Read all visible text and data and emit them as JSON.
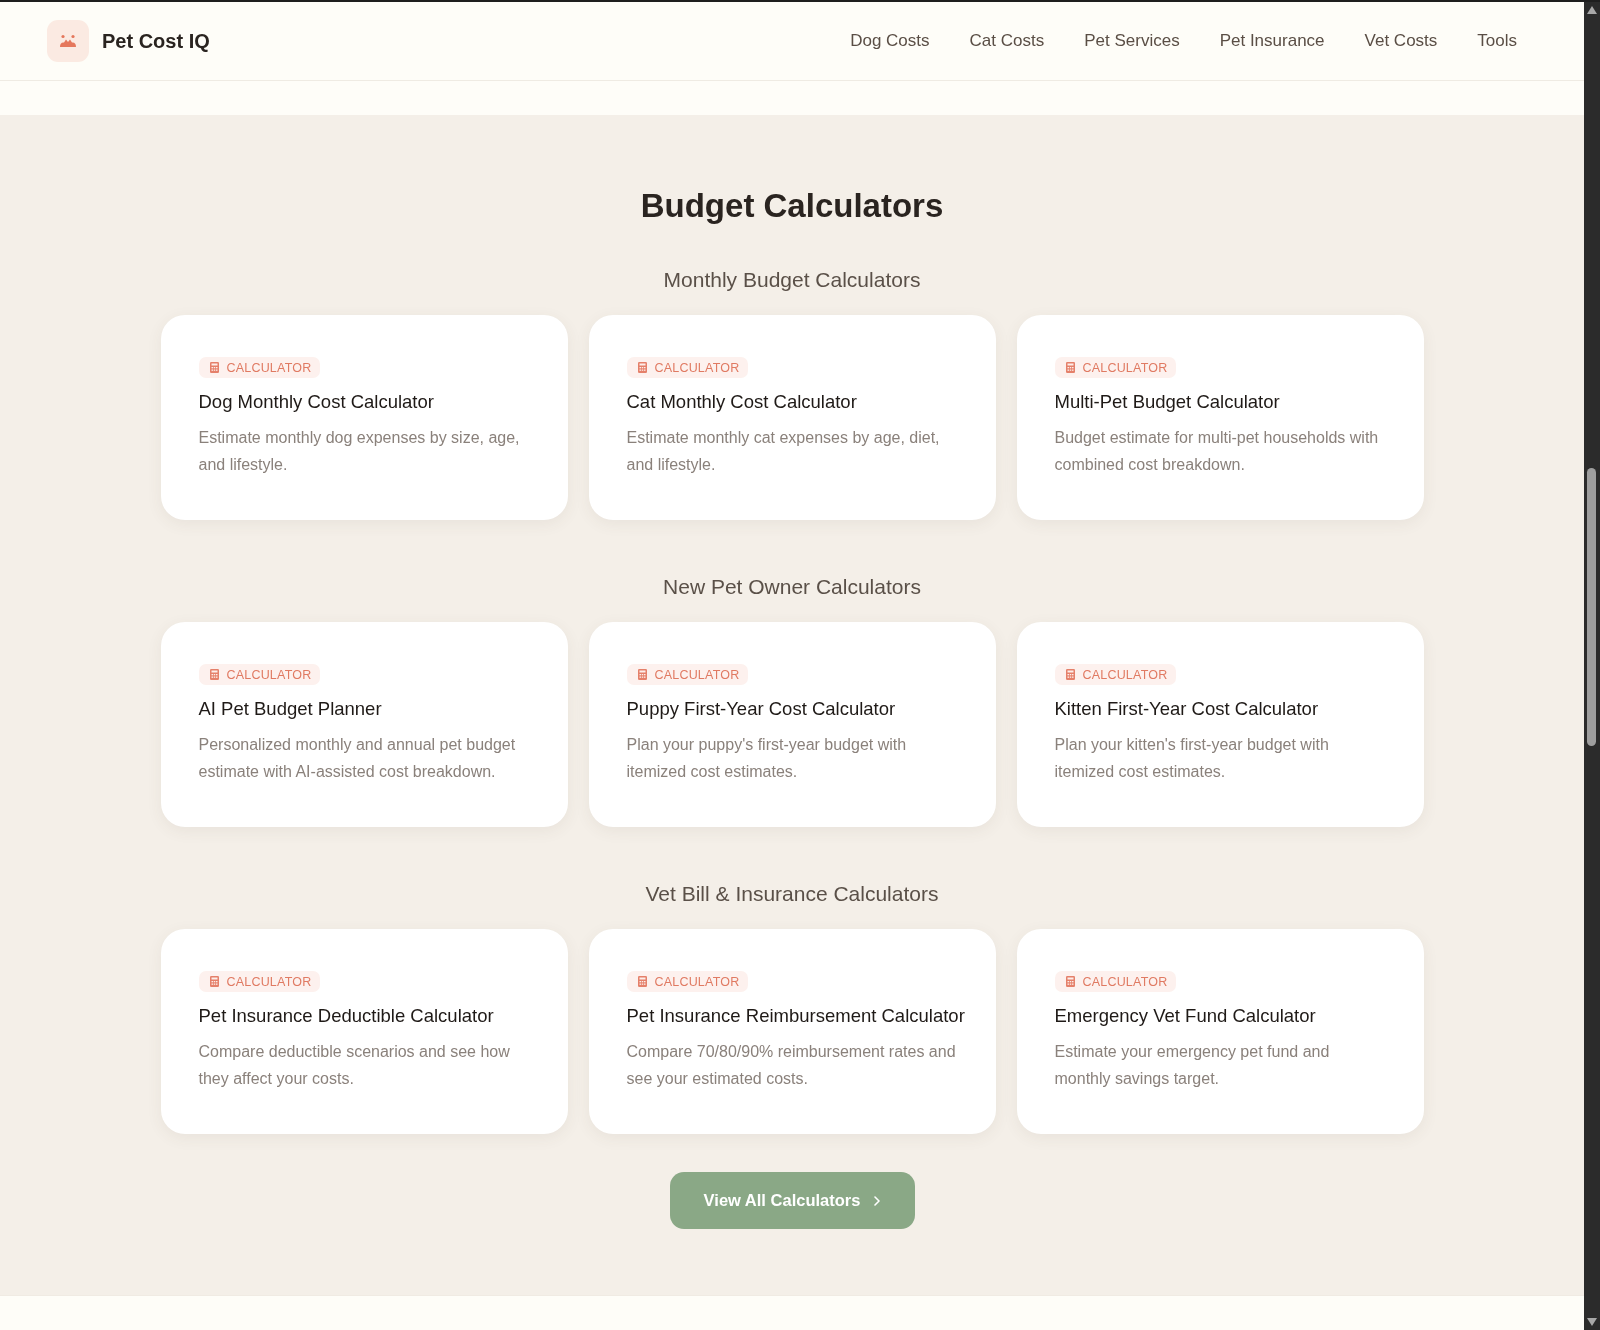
{
  "header": {
    "brand": "Pet Cost IQ",
    "nav": [
      "Dog Costs",
      "Cat Costs",
      "Pet Services",
      "Pet Insurance",
      "Vet Costs",
      "Tools"
    ]
  },
  "section": {
    "title": "Budget Calculators",
    "groups": [
      {
        "title": "Monthly Budget Calculators",
        "cards": [
          {
            "badge": "CALCULATOR",
            "title": "Dog Monthly Cost Calculator",
            "description": "Estimate monthly dog expenses by size, age, and lifestyle."
          },
          {
            "badge": "CALCULATOR",
            "title": "Cat Monthly Cost Calculator",
            "description": "Estimate monthly cat expenses by age, diet, and lifestyle."
          },
          {
            "badge": "CALCULATOR",
            "title": "Multi-Pet Budget Calculator",
            "description": "Budget estimate for multi-pet households with combined cost breakdown."
          }
        ]
      },
      {
        "title": "New Pet Owner Calculators",
        "cards": [
          {
            "badge": "CALCULATOR",
            "title": "AI Pet Budget Planner",
            "description": "Personalized monthly and annual pet budget estimate with AI-assisted cost breakdown."
          },
          {
            "badge": "CALCULATOR",
            "title": "Puppy First-Year Cost Calculator",
            "description": "Plan your puppy's first-year budget with itemized cost estimates."
          },
          {
            "badge": "CALCULATOR",
            "title": "Kitten First-Year Cost Calculator",
            "description": "Plan your kitten's first-year budget with itemized cost estimates."
          }
        ]
      },
      {
        "title": "Vet Bill & Insurance Calculators",
        "cards": [
          {
            "badge": "CALCULATOR",
            "title": "Pet Insurance Deductible Calculator",
            "description": "Compare deductible scenarios and see how they affect your costs."
          },
          {
            "badge": "CALCULATOR",
            "title": "Pet Insurance Reimbursement Calculator",
            "description": "Compare 70/80/90% reimbursement rates and see your estimated costs."
          },
          {
            "badge": "CALCULATOR",
            "title": "Emergency Vet Fund Calculator",
            "description": "Estimate your emergency pet fund and monthly savings target."
          }
        ]
      }
    ],
    "button": "View All Calculators"
  }
}
